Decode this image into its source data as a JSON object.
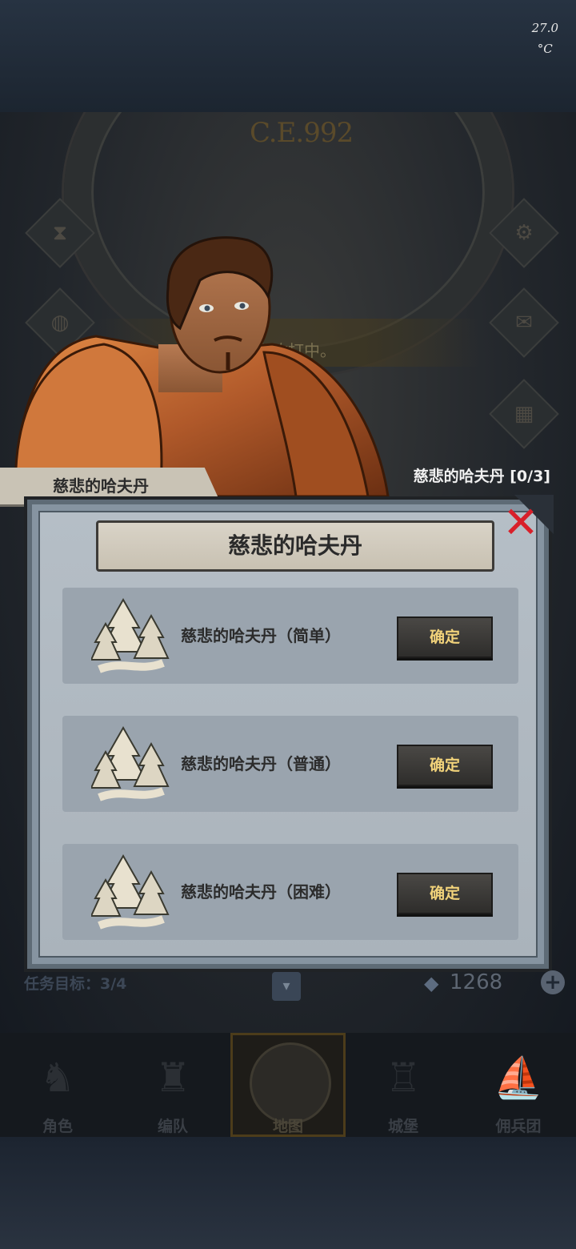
{
  "status": {
    "temperature": "27.0",
    "temperature_unit": "°C"
  },
  "map": {
    "year": "C.E.992",
    "banner_text": "堡垒攻打中。"
  },
  "npc": {
    "name": "慈悲的哈夫丹",
    "quest_progress": "慈悲的哈夫丹 [0/3]"
  },
  "dialog": {
    "title": "慈悲的哈夫丹",
    "options": [
      {
        "label": "慈悲的哈夫丹（简单）",
        "button": "确定"
      },
      {
        "label": "慈悲的哈夫丹（普通）",
        "button": "确定"
      },
      {
        "label": "慈悲的哈夫丹（困难）",
        "button": "确定"
      }
    ]
  },
  "hud": {
    "task_target": "任务目标：3/4",
    "gems": "1268"
  },
  "nav": {
    "items": [
      {
        "label": "角色",
        "icon": "knight-icon"
      },
      {
        "label": "编队",
        "icon": "helmet-icon"
      },
      {
        "label": "地图",
        "icon": "compass-icon"
      },
      {
        "label": "城堡",
        "icon": "castle-icon"
      },
      {
        "label": "佣兵团",
        "icon": "ship-icon"
      }
    ],
    "active": "地图"
  },
  "colors": {
    "close_red": "#d8202a",
    "button_text": "#f1d27a",
    "panel_bg": "#aab3bb"
  }
}
